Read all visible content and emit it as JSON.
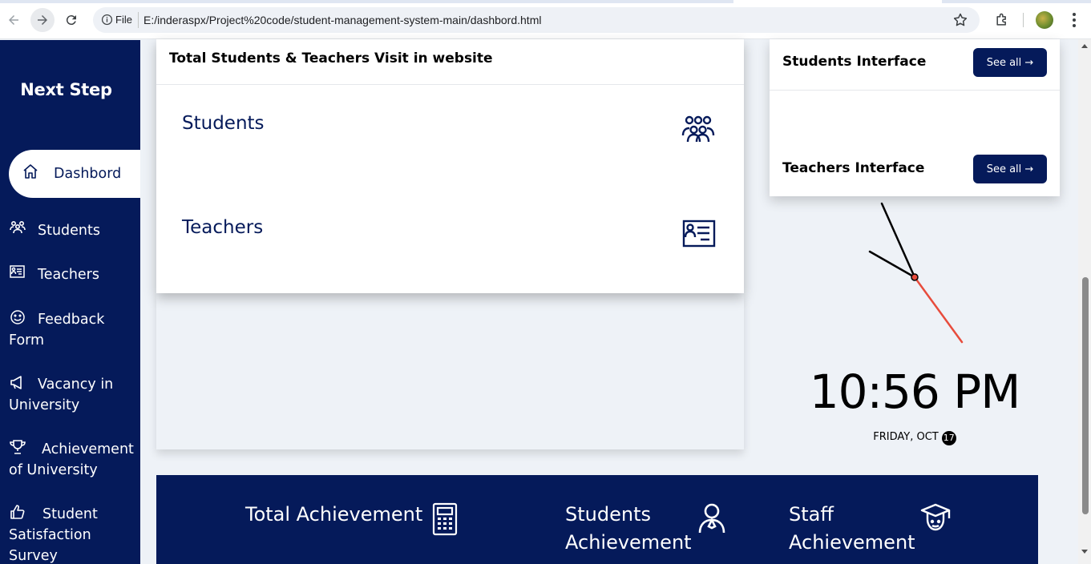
{
  "browser": {
    "file_chip": "File",
    "url": "E:/inderaspx/Project%20code/student-management-system-main/dashbord.html"
  },
  "sidebar": {
    "brand": "Next Step",
    "items": [
      {
        "label": "Dashbord",
        "icon": "home-icon",
        "active": true
      },
      {
        "label": "Students",
        "icon": "users-icon"
      },
      {
        "label": "Teachers",
        "icon": "teacher-board-icon"
      },
      {
        "label": "Feedback Form",
        "icon": "smile-icon"
      },
      {
        "label": "Vacancy in University",
        "icon": "megaphone-icon"
      },
      {
        "label": "Achievement of University",
        "icon": "trophy-icon"
      },
      {
        "label": "Student Satisfaction Survey",
        "icon": "thumbs-up-icon"
      }
    ]
  },
  "visits": {
    "title": "Total Students & Teachers Visit in website",
    "rows": [
      {
        "label": "Students",
        "icon": "users-icon"
      },
      {
        "label": "Teachers",
        "icon": "teacher-board-icon"
      }
    ]
  },
  "interfaces": {
    "items": [
      {
        "label": "Students Interface",
        "button": "See all →"
      },
      {
        "label": "Teachers Interface",
        "button": "See all →"
      }
    ]
  },
  "clock": {
    "time": "10:56 PM",
    "date_text": "FRIDAY, OCT",
    "day": "17"
  },
  "achievements": {
    "total": "Total Achievement",
    "students": "Students Achievement",
    "staff": "Staff Achievement"
  },
  "colors": {
    "navy": "#051a5a",
    "second_hand": "#e74c3c"
  }
}
